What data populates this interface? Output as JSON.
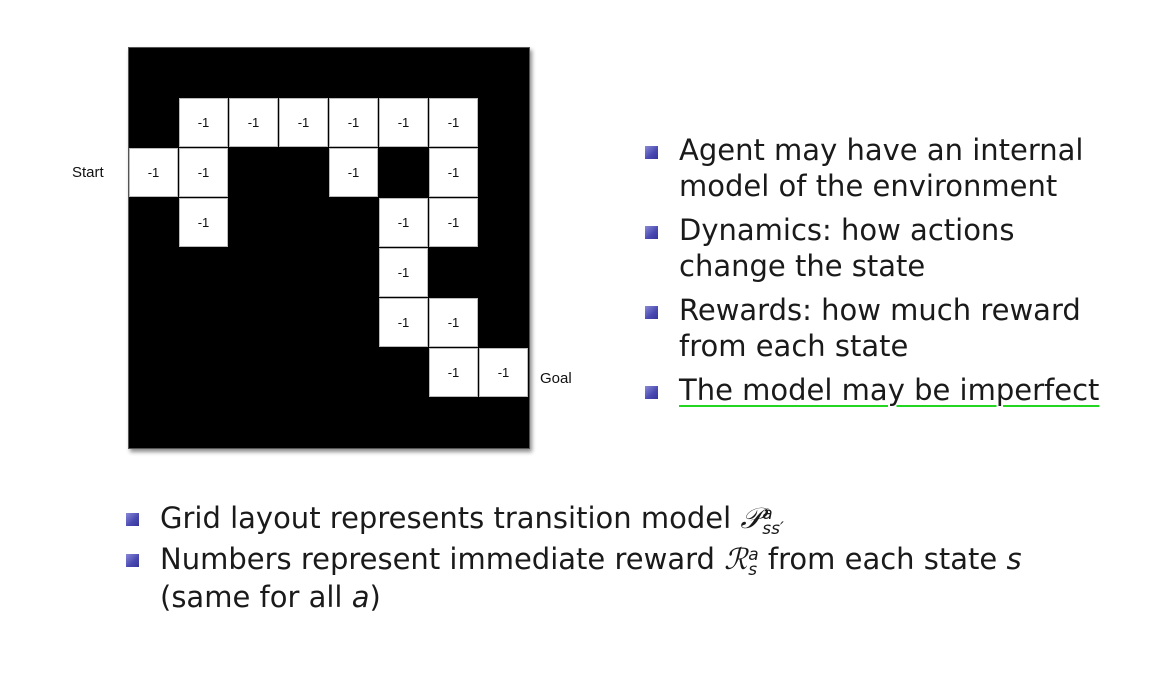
{
  "maze": {
    "cells": [
      {
        "row": 1,
        "col": 1,
        "value": "-1"
      },
      {
        "row": 1,
        "col": 2,
        "value": "-1"
      },
      {
        "row": 1,
        "col": 3,
        "value": "-1"
      },
      {
        "row": 1,
        "col": 4,
        "value": "-1"
      },
      {
        "row": 1,
        "col": 5,
        "value": "-1"
      },
      {
        "row": 1,
        "col": 6,
        "value": "-1"
      },
      {
        "row": 2,
        "col": 0,
        "value": "-1"
      },
      {
        "row": 2,
        "col": 1,
        "value": "-1"
      },
      {
        "row": 2,
        "col": 4,
        "value": "-1"
      },
      {
        "row": 2,
        "col": 6,
        "value": "-1"
      },
      {
        "row": 3,
        "col": 1,
        "value": "-1"
      },
      {
        "row": 3,
        "col": 5,
        "value": "-1"
      },
      {
        "row": 3,
        "col": 6,
        "value": "-1"
      },
      {
        "row": 4,
        "col": 5,
        "value": "-1"
      },
      {
        "row": 5,
        "col": 5,
        "value": "-1"
      },
      {
        "row": 5,
        "col": 6,
        "value": "-1"
      },
      {
        "row": 6,
        "col": 6,
        "value": "-1"
      },
      {
        "row": 6,
        "col": 7,
        "value": "-1"
      }
    ],
    "start_label": "Start",
    "goal_label": "Goal"
  },
  "right_bullets": [
    "Agent may have an internal model of the environment",
    "Dynamics: how actions change the state",
    "Rewards: how much reward from each state",
    "The model may be imperfect"
  ],
  "bottom_bullets": {
    "b1_text": "Grid layout represents transition model ",
    "b1_symbol": "𝒫",
    "b1_sup": "a",
    "b1_sub": "ss′",
    "b2_text_a": "Numbers represent immediate reward ",
    "b2_symbol": "ℛ",
    "b2_sup": "a",
    "b2_sub": "s",
    "b2_text_b": " from each state ",
    "b2_state": "s",
    "b2_text_c": "(same for all ",
    "b2_action": "a",
    "b2_text_d": ")"
  },
  "colors": {
    "bullet": "#4848b0",
    "underline": "#22d622",
    "maze_wall": "#000000"
  }
}
